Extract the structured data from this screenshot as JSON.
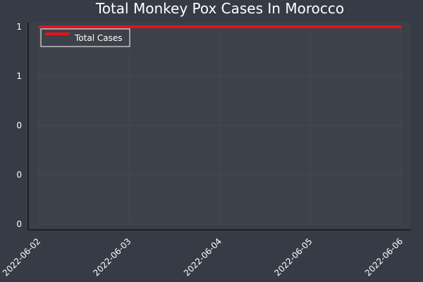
{
  "colors": {
    "background": "#363b45",
    "plot_area": "#3d414a",
    "grid": "#454952",
    "axis": "#000000",
    "text": "#ffffff",
    "series": "#e0141e"
  },
  "chart_data": {
    "type": "line",
    "title": "Total Monkey Pox Cases In Morocco",
    "xlabel": "",
    "ylabel": "",
    "x": [
      "2022-06-02",
      "2022-06-03",
      "2022-06-04",
      "2022-06-05",
      "2022-06-06"
    ],
    "x_tick_labels": [
      "2022-06-02",
      "2022-06-03",
      "2022-06-04",
      "2022-06-05",
      "2022-06-06"
    ],
    "y_ticks": [
      0,
      0.25,
      0.5,
      0.75,
      1
    ],
    "y_tick_labels": [
      "0",
      "0",
      "0",
      "1",
      "1"
    ],
    "ylim": [
      0,
      1
    ],
    "grid": true,
    "legend_position": "top-left",
    "series": [
      {
        "name": "Total Cases",
        "values": [
          1,
          1,
          1,
          1,
          1
        ]
      }
    ]
  }
}
